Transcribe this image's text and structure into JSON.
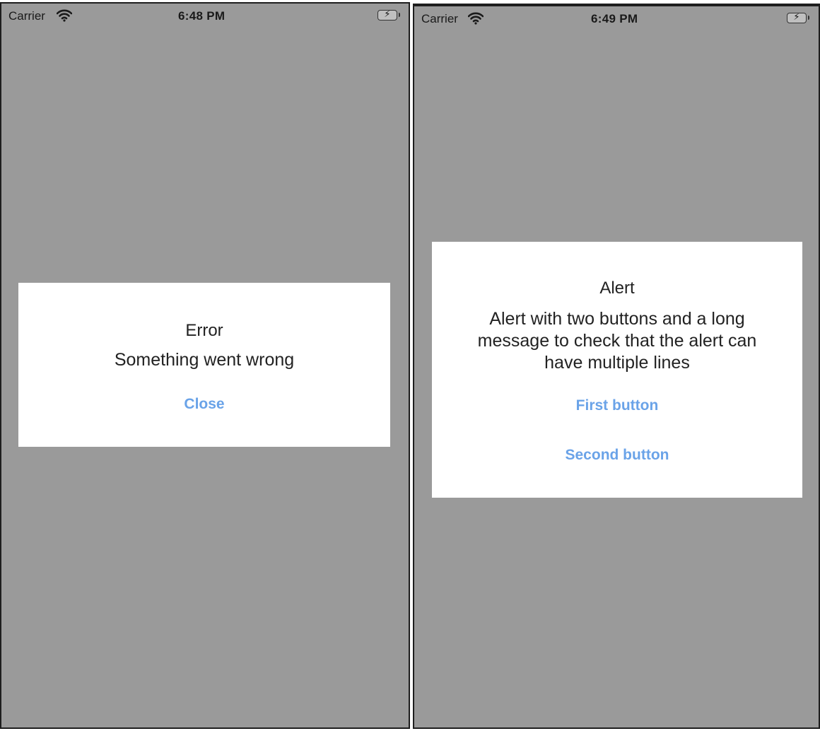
{
  "screens": [
    {
      "status_bar": {
        "carrier": "Carrier",
        "time": "6:48 PM"
      },
      "alert": {
        "title": "Error",
        "message": "Something went wrong",
        "buttons": [
          "Close"
        ]
      }
    },
    {
      "status_bar": {
        "carrier": "Carrier",
        "time": "6:49 PM"
      },
      "alert": {
        "title": "Alert",
        "message": "Alert with two buttons and a long message to check that the alert can have multiple lines",
        "buttons": [
          "First button",
          "Second button"
        ]
      }
    }
  ],
  "icons": {
    "wifi": "wifi-icon",
    "battery": "battery-charging-icon"
  },
  "colors": {
    "backdrop": "#9a9a9a",
    "alert_bg": "#ffffff",
    "button_text": "#6aa3e8"
  }
}
